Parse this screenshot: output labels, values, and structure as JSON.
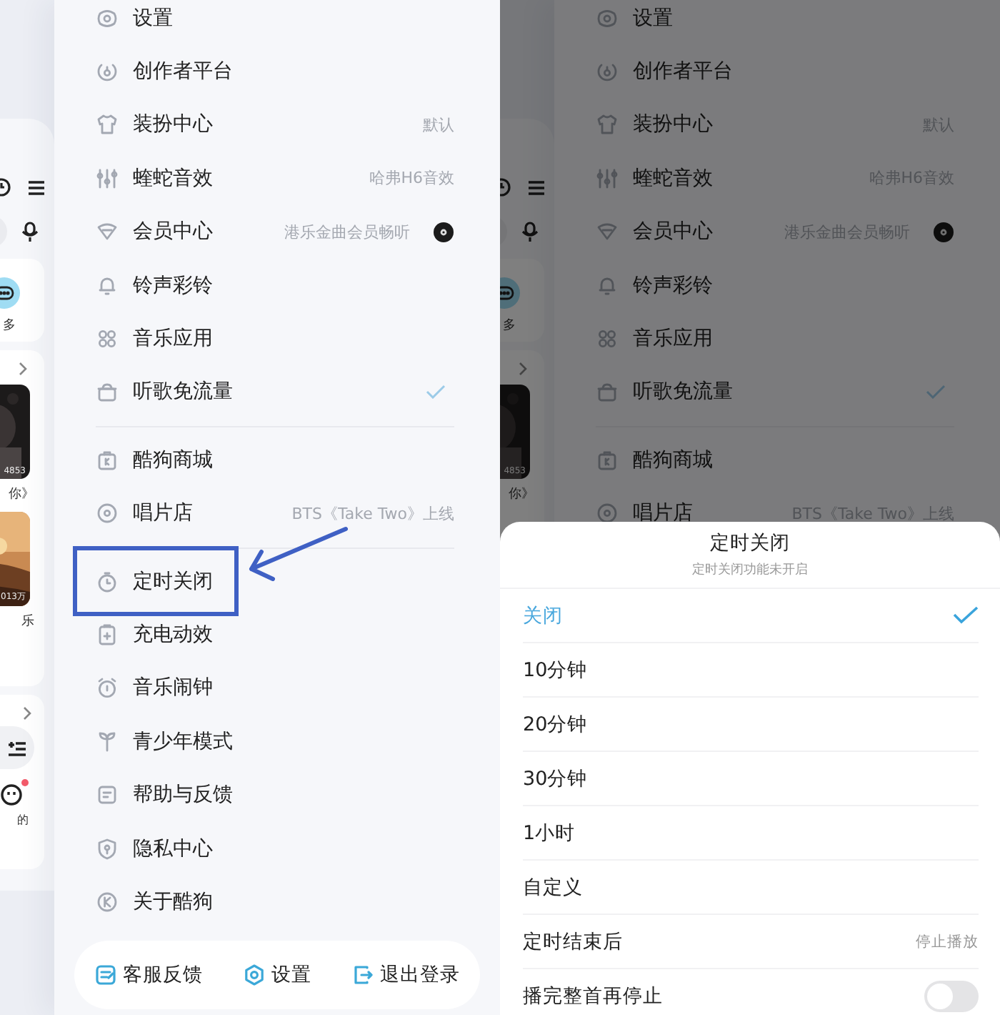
{
  "screens": [
    {
      "peek": {
        "more_label": "多",
        "tiles": [
          {
            "count": "4853",
            "caption": "你》"
          },
          {
            "count": "013万",
            "caption": "乐"
          }
        ],
        "mine_label": "的",
        "mine_dot": true
      },
      "drawer": {
        "groups": [
          {
            "items": [
              {
                "label": "设置",
                "kind": "plain",
                "checked": false,
                "highlighted": false
              },
              {
                "label": "创作者平台",
                "kind": "plain",
                "checked": false,
                "highlighted": false
              },
              {
                "label": "装扮中心",
                "kind": "value",
                "value": "默认",
                "checked": false,
                "highlighted": false
              },
              {
                "label": "蝰蛇音效",
                "kind": "value",
                "value": "哈弗H6音效",
                "checked": false,
                "highlighted": false
              },
              {
                "label": "会员中心",
                "kind": "value-art",
                "value": "港乐金曲会员畅听",
                "checked": false,
                "highlighted": false
              },
              {
                "label": "铃声彩铃",
                "kind": "plain",
                "checked": false,
                "highlighted": false
              },
              {
                "label": "音乐应用",
                "kind": "plain",
                "checked": false,
                "highlighted": false
              },
              {
                "label": "听歌免流量",
                "kind": "plain",
                "checked": true,
                "highlighted": false
              }
            ]
          },
          {
            "items": [
              {
                "label": "酷狗商城",
                "kind": "plain",
                "checked": false,
                "highlighted": false
              },
              {
                "label": "唱片店",
                "kind": "value",
                "value": "BTS《Take Two》上线",
                "checked": false,
                "highlighted": false
              }
            ]
          },
          {
            "items": [
              {
                "label": "定时关闭",
                "kind": "plain",
                "checked": false,
                "highlighted": true
              },
              {
                "label": "充电动效",
                "kind": "plain",
                "checked": false,
                "highlighted": false
              },
              {
                "label": "音乐闹钟",
                "kind": "plain",
                "checked": false,
                "highlighted": false
              },
              {
                "label": "青少年模式",
                "kind": "plain",
                "checked": false,
                "highlighted": false
              },
              {
                "label": "帮助与反馈",
                "kind": "plain",
                "checked": false,
                "highlighted": false
              },
              {
                "label": "隐私中心",
                "kind": "plain",
                "checked": false,
                "highlighted": false
              },
              {
                "label": "关于酷狗",
                "kind": "plain",
                "checked": false,
                "highlighted": false
              }
            ]
          }
        ],
        "footer": [
          {
            "label": "客服反馈"
          },
          {
            "label": "设置"
          },
          {
            "label": "退出登录"
          }
        ]
      }
    },
    {
      "peek": {
        "more_label": "多",
        "tiles": [
          {
            "count": "4853",
            "caption": "你》"
          }
        ]
      },
      "drawer": {
        "groups": [
          {
            "items": [
              {
                "label": "设置",
                "kind": "plain",
                "checked": false
              },
              {
                "label": "创作者平台",
                "kind": "plain",
                "checked": false
              },
              {
                "label": "装扮中心",
                "kind": "value",
                "value": "默认",
                "checked": false
              },
              {
                "label": "蝰蛇音效",
                "kind": "value",
                "value": "哈弗H6音效",
                "checked": false
              },
              {
                "label": "会员中心",
                "kind": "value-art",
                "value": "港乐金曲会员畅听",
                "checked": false
              },
              {
                "label": "铃声彩铃",
                "kind": "plain",
                "checked": false
              },
              {
                "label": "音乐应用",
                "kind": "plain",
                "checked": false
              },
              {
                "label": "听歌免流量",
                "kind": "plain",
                "checked": true
              }
            ]
          },
          {
            "items": [
              {
                "label": "酷狗商城",
                "kind": "plain",
                "checked": false
              },
              {
                "label": "唱片店",
                "kind": "value",
                "value": "BTS《Take Two》上线",
                "checked": false
              }
            ]
          }
        ]
      },
      "sheet": {
        "title": "定时关闭",
        "subtitle": "定时关闭功能未开启",
        "options": [
          {
            "label": "关闭",
            "selected": true
          },
          {
            "label": "10分钟",
            "selected": false
          },
          {
            "label": "20分钟",
            "selected": false
          },
          {
            "label": "30分钟",
            "selected": false
          },
          {
            "label": "1小时",
            "selected": false
          },
          {
            "label": "自定义",
            "selected": false
          }
        ],
        "settings": [
          {
            "kind": "value",
            "label": "定时结束后",
            "value": "停止播放"
          },
          {
            "kind": "toggle",
            "label": "播完整首再停止",
            "on": false
          }
        ]
      }
    }
  ]
}
